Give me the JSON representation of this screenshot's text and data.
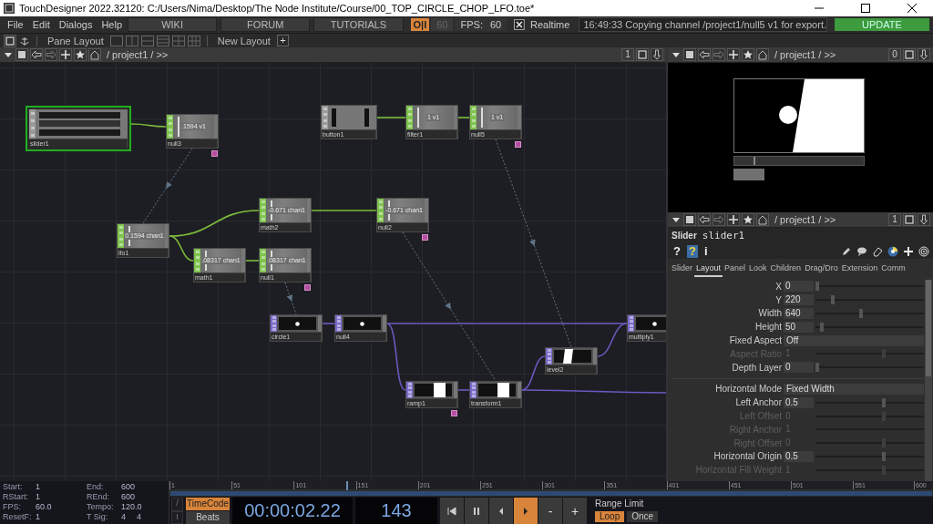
{
  "window": {
    "title": "TouchDesigner 2022.32120: C:/Users/Nima/Desktop/The Node Institute/Course/00_TOP_CIRCLE_CHOP_LFO.toe*"
  },
  "menu_bar": {
    "menus": [
      "File",
      "Edit",
      "Dialogs",
      "Help"
    ],
    "links": [
      "WIKI",
      "FORUM",
      "TUTORIALS"
    ],
    "perform_toggle": "O|I",
    "fps_setting": "60",
    "fps_label": "FPS:",
    "fps_value": "60",
    "realtime": {
      "label": "Realtime",
      "checked": true
    },
    "status": "16:49:33 Copying channel /project1/null5 v1 for export.",
    "update_button": "UPDATE"
  },
  "pane_bar": {
    "pane_layout": "Pane Layout",
    "new_layout": "New Layout",
    "add": "+"
  },
  "network": {
    "path": "/ project1 / >>",
    "pane_index": "1",
    "nodes": [
      {
        "name": "slider1",
        "kind": "slider_comp",
        "selected": true,
        "flagged": false
      },
      {
        "name": "null3",
        "kind": "chop",
        "value": ".1594 v1",
        "selected": false,
        "flagged": true
      },
      {
        "name": "button1",
        "kind": "button_comp",
        "selected": false,
        "flagged": false
      },
      {
        "name": "filter1",
        "kind": "chop",
        "value": "1 v1",
        "selected": false,
        "flagged": false
      },
      {
        "name": "null5",
        "kind": "chop",
        "value": "1 v1",
        "selected": false,
        "flagged": true
      },
      {
        "name": "lfo1",
        "kind": "chop",
        "value": "0.1594 chan1",
        "selected": false,
        "flagged": false
      },
      {
        "name": "math2",
        "kind": "chop",
        "value": "-0.671 chan1",
        "selected": false,
        "flagged": false
      },
      {
        "name": "null2",
        "kind": "chop",
        "value": "-0.671 chan1",
        "selected": false,
        "flagged": true
      },
      {
        "name": "math1",
        "kind": "chop",
        "value": ".08317 chan1",
        "selected": false,
        "flagged": false
      },
      {
        "name": "null1",
        "kind": "chop",
        "value": ".08317 chan1",
        "selected": false,
        "flagged": true
      },
      {
        "name": "circle1",
        "kind": "dot_top",
        "selected": false,
        "flagged": false
      },
      {
        "name": "null4",
        "kind": "dot_top",
        "selected": false,
        "flagged": false
      },
      {
        "name": "ramp1",
        "kind": "ramp_top",
        "selected": false,
        "flagged": true
      },
      {
        "name": "transform1",
        "kind": "ramp_top",
        "selected": false,
        "flagged": false
      },
      {
        "name": "level2",
        "kind": "skew_top",
        "selected": false,
        "flagged": false
      },
      {
        "name": "multiply1",
        "kind": "dot_top",
        "selected": false,
        "flagged": false
      }
    ]
  },
  "viewer": {
    "path": "/ project1 / >>",
    "pane_index": "0"
  },
  "parameters": {
    "path": "/ project1 / >>",
    "pane_index": "1",
    "op_type": "Slider",
    "op_name": "slider1",
    "help_buttons": [
      "?",
      "?",
      "i"
    ],
    "tabs": [
      {
        "label": "Slider",
        "selected": false
      },
      {
        "label": "Layout",
        "selected": true
      },
      {
        "label": "Panel",
        "selected": false
      },
      {
        "label": "Look",
        "selected": false
      },
      {
        "label": "Children",
        "selected": false
      },
      {
        "label": "Drag/Dro",
        "selected": false
      },
      {
        "label": "Extension",
        "selected": false
      },
      {
        "label": "Comm",
        "selected": false
      }
    ],
    "params": [
      {
        "kind": "number",
        "label": "X",
        "value": "0",
        "level": 0.02,
        "disabled": false
      },
      {
        "kind": "number",
        "label": "Y",
        "value": "220",
        "level": 0.16,
        "disabled": false
      },
      {
        "kind": "number",
        "label": "Width",
        "value": "640",
        "level": 0.42,
        "disabled": false
      },
      {
        "kind": "number",
        "label": "Height",
        "value": "50",
        "level": 0.06,
        "disabled": false
      },
      {
        "kind": "menu",
        "label": "Fixed Aspect",
        "value": "Off",
        "disabled": false
      },
      {
        "kind": "number",
        "label": "Aspect Ratio",
        "value": "1",
        "level": 0.63,
        "disabled": true
      },
      {
        "kind": "number",
        "label": "Depth Layer",
        "value": "0",
        "level": 0.02,
        "disabled": false
      },
      {
        "kind": "separator"
      },
      {
        "kind": "menu",
        "label": "Horizontal Mode",
        "value": "Fixed Width",
        "disabled": false
      },
      {
        "kind": "number",
        "label": "Left Anchor",
        "value": "0.5",
        "level": 0.63,
        "disabled": false
      },
      {
        "kind": "number",
        "label": "Left Offset",
        "value": "0",
        "level": 0.63,
        "disabled": true
      },
      {
        "kind": "number",
        "label": "Right Anchor",
        "value": "1",
        "disabled": true
      },
      {
        "kind": "number",
        "label": "Right Offset",
        "value": "0",
        "level": 0.63,
        "disabled": true
      },
      {
        "kind": "number",
        "label": "Horizontal Origin",
        "value": "0.5",
        "level": 0.63,
        "disabled": false
      },
      {
        "kind": "number",
        "label": "Horizontal Fill Weight",
        "value": "1",
        "level": 0.63,
        "disabled": true
      }
    ]
  },
  "timeline": {
    "info": [
      {
        "label": "Start:",
        "values": [
          "1"
        ]
      },
      {
        "label": "End:",
        "values": [
          "600"
        ]
      },
      {
        "label": "RStart:",
        "values": [
          "1"
        ]
      },
      {
        "label": "REnd:",
        "values": [
          "600"
        ]
      },
      {
        "label": "FPS:",
        "values": [
          "60.0"
        ]
      },
      {
        "label": "Tempo:",
        "values": [
          "120.0"
        ]
      },
      {
        "label": "ResetF:",
        "values": [
          "1"
        ]
      },
      {
        "label": "T Sig:",
        "values": [
          "4",
          "4"
        ]
      }
    ],
    "ticks": [
      "1",
      "51",
      "101",
      "151",
      "201",
      "251",
      "301",
      "351",
      "401",
      "451",
      "501",
      "551",
      "600"
    ],
    "playhead": {
      "level": 0.237
    },
    "side_buttons": [
      "/",
      "I"
    ],
    "time_modes": [
      {
        "label": "TimeCode",
        "selected": true
      },
      {
        "label": "Beats",
        "selected": false
      }
    ],
    "timecode": "00:00:02.22",
    "frame": "143",
    "transport": [
      {
        "kind": "start",
        "selected": false
      },
      {
        "kind": "pause",
        "selected": false
      },
      {
        "kind": "step_back",
        "selected": false
      },
      {
        "kind": "play",
        "selected": true
      },
      {
        "kind": "minus",
        "label": "-",
        "selected": false
      },
      {
        "kind": "plus",
        "label": "+",
        "selected": false
      }
    ],
    "range_label": "Range Limit",
    "range_modes": [
      {
        "label": "Loop",
        "selected": true
      },
      {
        "label": "Once",
        "selected": false
      }
    ]
  }
}
